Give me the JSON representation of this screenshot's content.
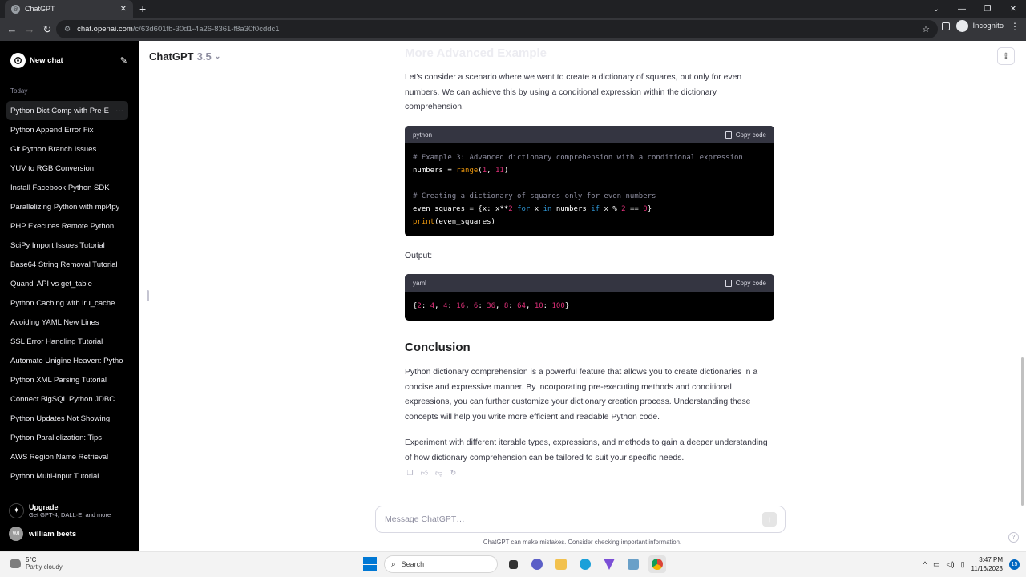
{
  "browser": {
    "tab_title": "ChatGPT",
    "url_host": "chat.openai.com",
    "url_path": "/c/63d601fb-30d1-4a26-8361-f8a30f0cddc1",
    "incognito_label": "Incognito"
  },
  "sidebar": {
    "new_chat": "New chat",
    "section": "Today",
    "items": [
      {
        "label": "Python Dict Comp with Pre-E",
        "active": true
      },
      {
        "label": "Python Append Error Fix"
      },
      {
        "label": "Git Python Branch Issues"
      },
      {
        "label": "YUV to RGB Conversion"
      },
      {
        "label": "Install Facebook Python SDK"
      },
      {
        "label": "Parallelizing Python with mpi4py"
      },
      {
        "label": "PHP Executes Remote Python"
      },
      {
        "label": "SciPy Import Issues Tutorial"
      },
      {
        "label": "Base64 String Removal Tutorial"
      },
      {
        "label": "Quandl API vs get_table"
      },
      {
        "label": "Python Caching with lru_cache"
      },
      {
        "label": "Avoiding YAML New Lines"
      },
      {
        "label": "SSL Error Handling Tutorial"
      },
      {
        "label": "Automate Unigine Heaven: Pytho"
      },
      {
        "label": "Python XML Parsing Tutorial"
      },
      {
        "label": "Connect BigSQL Python JDBC"
      },
      {
        "label": "Python Updates Not Showing"
      },
      {
        "label": "Python Parallelization: Tips"
      },
      {
        "label": "AWS Region Name Retrieval"
      },
      {
        "label": "Python Multi-Input Tutorial"
      }
    ],
    "upgrade_title": "Upgrade",
    "upgrade_sub": "Get GPT-4, DALL·E, and more",
    "user_initials": "WI",
    "user_name": "william beets"
  },
  "header": {
    "model": "ChatGPT",
    "version": "3.5"
  },
  "content": {
    "faded_heading": "More Advanced Example",
    "para1": "Let's consider a scenario where we want to create a dictionary of squares, but only for even numbers. We can achieve this by using a conditional expression within the dictionary comprehension.",
    "code1_lang": "python",
    "copy_label": "Copy code",
    "code1_line1": "# Example 3: Advanced dictionary comprehension with a conditional expression",
    "code1_line2": "numbers = range(1, 11)",
    "code1_line4": "# Creating a dictionary of squares only for even numbers",
    "code1_line5": "even_squares = {x: x**2 for x in numbers if x % 2 == 0}",
    "code1_line6": "print(even_squares)",
    "output_label": "Output:",
    "code2_lang": "yaml",
    "code2_line1": "{2: 4, 4: 16, 6: 36, 8: 64, 10: 100}",
    "conclusion_heading": "Conclusion",
    "para2": "Python dictionary comprehension is a powerful feature that allows you to create dictionaries in a concise and expressive manner. By incorporating pre-executing methods and conditional expressions, you can further customize your dictionary creation process. Understanding these concepts will help you write more efficient and readable Python code.",
    "para3": "Experiment with different iterable types, expressions, and methods to gain a deeper understanding of how dictionary comprehension can be tailored to suit your specific needs."
  },
  "composer": {
    "placeholder": "Message ChatGPT…",
    "disclaimer": "ChatGPT can make mistakes. Consider checking important information."
  },
  "taskbar": {
    "temp": "5°C",
    "weather": "Partly cloudy",
    "search": "Search",
    "time": "3:47 PM",
    "date": "11/16/2023",
    "notifications": "15"
  }
}
